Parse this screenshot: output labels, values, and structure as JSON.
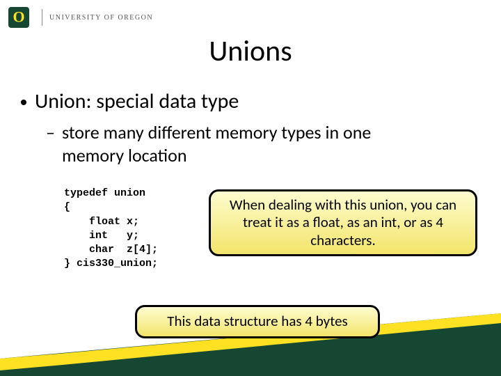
{
  "header": {
    "university": "UNIVERSITY OF OREGON"
  },
  "title": "Unions",
  "bullets": {
    "level1": "Union: special data type",
    "level2": "store many different memory types in one memory location"
  },
  "code": "typedef union\n{\n    float x;\n    int   y;\n    char  z[4];\n} cis330_union;",
  "callouts": {
    "c1": "When dealing with this union, you can treat it as a float, as an int, or as 4 characters.",
    "c2": "This data structure has 4 bytes"
  }
}
